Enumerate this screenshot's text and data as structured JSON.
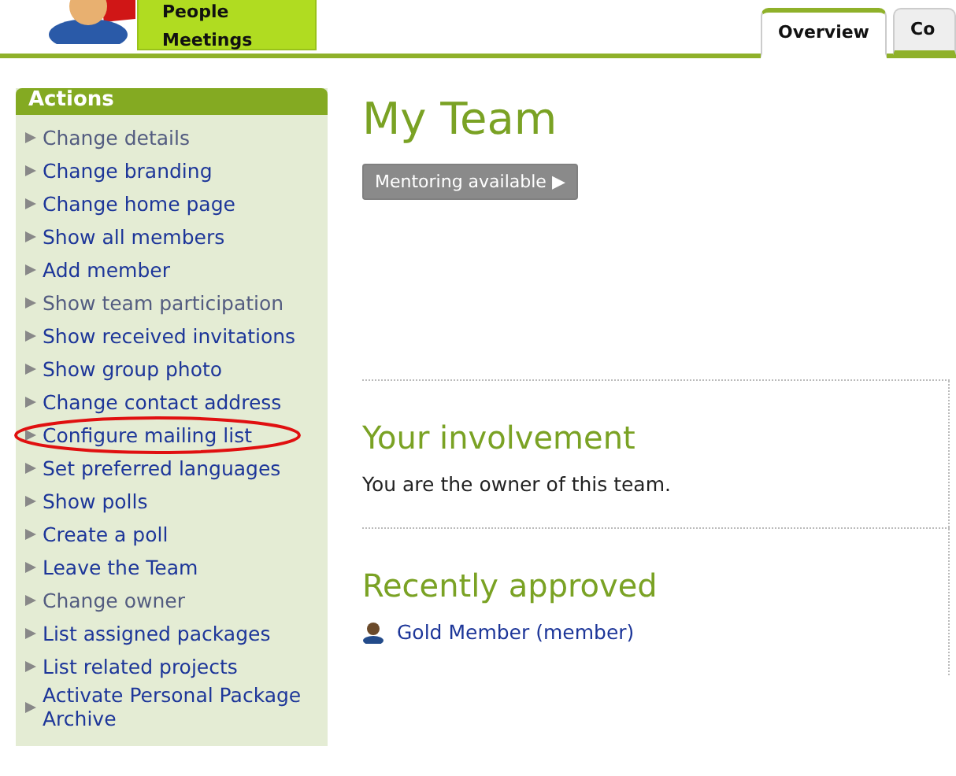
{
  "header": {
    "nav_links": [
      {
        "label": "People"
      },
      {
        "label": "Meetings"
      }
    ],
    "tabs": [
      {
        "label": "Overview",
        "selected": true
      },
      {
        "label": "Co",
        "selected": false
      }
    ]
  },
  "sidebar": {
    "title": "Actions",
    "items": [
      {
        "label": "Change details",
        "visited": true,
        "highlighted": false
      },
      {
        "label": "Change branding",
        "visited": false,
        "highlighted": false
      },
      {
        "label": "Change home page",
        "visited": false,
        "highlighted": false
      },
      {
        "label": "Show all members",
        "visited": false,
        "highlighted": false
      },
      {
        "label": "Add member",
        "visited": false,
        "highlighted": false
      },
      {
        "label": "Show team participation",
        "visited": true,
        "highlighted": false
      },
      {
        "label": "Show received invitations",
        "visited": false,
        "highlighted": false
      },
      {
        "label": "Show group photo",
        "visited": false,
        "highlighted": false
      },
      {
        "label": "Change contact address",
        "visited": false,
        "highlighted": false
      },
      {
        "label": "Configure mailing list",
        "visited": false,
        "highlighted": true
      },
      {
        "label": "Set preferred languages",
        "visited": false,
        "highlighted": false
      },
      {
        "label": "Show polls",
        "visited": false,
        "highlighted": false
      },
      {
        "label": "Create a poll",
        "visited": false,
        "highlighted": false
      },
      {
        "label": "Leave the Team",
        "visited": false,
        "highlighted": false
      },
      {
        "label": "Change owner",
        "visited": true,
        "highlighted": false
      },
      {
        "label": "List assigned packages",
        "visited": false,
        "highlighted": false
      },
      {
        "label": "List related projects",
        "visited": false,
        "highlighted": false
      },
      {
        "label": "Activate Personal Package Archive",
        "visited": false,
        "highlighted": false
      }
    ]
  },
  "main": {
    "title": "My Team",
    "mentoring_button": {
      "label": "Mentoring available ▶",
      "disabled": true
    },
    "involvement": {
      "heading": "Your involvement",
      "text": "You are the owner of this team."
    },
    "recently_approved": {
      "heading": "Recently approved",
      "members": [
        {
          "label": "Gold Member (member)"
        }
      ]
    }
  }
}
